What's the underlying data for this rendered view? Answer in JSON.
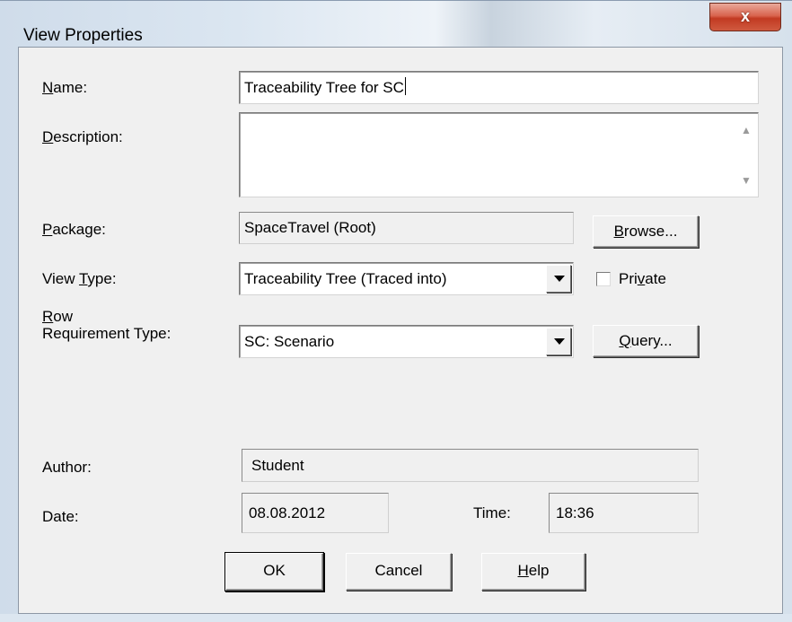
{
  "window": {
    "title": "View Properties",
    "close_glyph": "x"
  },
  "form": {
    "name": {
      "label": "Name:",
      "value": "Traceability Tree for SC"
    },
    "description": {
      "label": "Description:",
      "value": ""
    },
    "package": {
      "label": "Package:",
      "value": "SpaceTravel (Root)",
      "browse_label": "Browse..."
    },
    "view_type": {
      "label": "View Type:",
      "value": "Traceability Tree (Traced into)",
      "private_label": "Private",
      "private_checked": false
    },
    "row_requirement_type": {
      "label_line1": "Row",
      "label_line2": "Requirement Type:",
      "value": "SC: Scenario",
      "query_label": "Query..."
    },
    "author": {
      "label": "Author:",
      "value": "Student"
    },
    "date": {
      "label": "Date:",
      "value": "08.08.2012"
    },
    "time": {
      "label": "Time:",
      "value": "18:36"
    }
  },
  "buttons": {
    "ok": "OK",
    "cancel": "Cancel",
    "help": "Help"
  },
  "icons": {
    "scroll_up": "scroll-up-arrow-icon",
    "scroll_down": "scroll-down-arrow-icon",
    "dropdown": "dropdown-arrow-icon"
  }
}
